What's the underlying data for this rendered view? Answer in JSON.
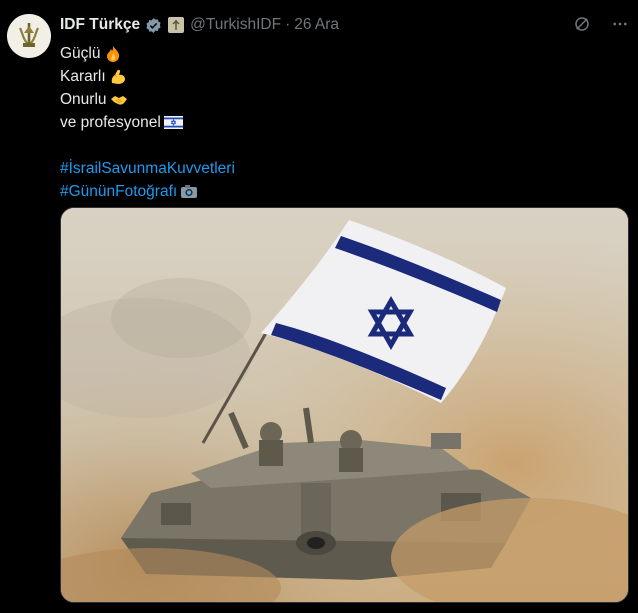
{
  "account": {
    "name": "IDF Türkçe",
    "handle": "@TurkishIDF",
    "separator": "·",
    "date": "26 Ara",
    "verified": true
  },
  "post": {
    "lines": [
      {
        "text": "Güçlü",
        "emoji": "fire-emoji"
      },
      {
        "text": "Kararlı",
        "emoji": "flexed-biceps-emoji"
      },
      {
        "text": "Onurlu",
        "emoji": "handshake-emoji"
      },
      {
        "text": "ve profesyonel",
        "emoji": "israel-flag-emoji"
      }
    ],
    "hashtags": [
      {
        "text": "#İsrailSavunmaKuvvetleri"
      },
      {
        "text": "#GününFotoğrafı",
        "emoji": "camera-emoji"
      }
    ]
  },
  "media": {
    "description_icon": "photo",
    "colors": {
      "sky": "#d8d0c0",
      "dust": "#c9a77a",
      "flag_blue": "#1b2a7a",
      "flag_white": "#f2f2f4",
      "tank": "#6e6a5e"
    }
  },
  "colors": {
    "background": "#000000",
    "text": "#e7e9ea",
    "muted": "#71767b",
    "link": "#1d9bf0",
    "verified": "#829aab"
  }
}
